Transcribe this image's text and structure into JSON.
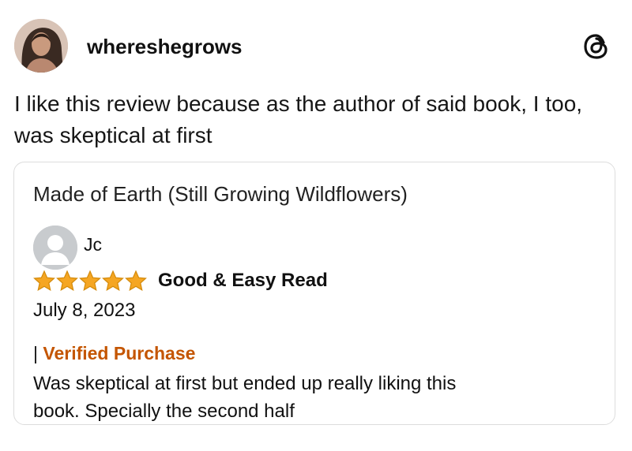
{
  "post": {
    "username": "whereshegrows",
    "text_line1": "I like this review because as the author of said book, I too,",
    "text_line2": "was skeptical at first"
  },
  "review_card": {
    "book_title": "Made of Earth (Still Growing Wildflowers)",
    "reviewer_name": "Jc",
    "rating": 5,
    "rating_max": 5,
    "review_title": "Good & Easy Read",
    "date": "July 8, 2023",
    "separator": "|",
    "verified_label": "Verified Purchase",
    "body_line1": "Was skeptical at first but ended up really liking this",
    "body_line2": "book. Specially the second half"
  },
  "icons": {
    "threads": "threads-logo-icon",
    "star": "star-icon",
    "default_avatar": "user-silhouette-icon"
  },
  "colors": {
    "star": "#f5a623",
    "star_stroke": "#d48a0a",
    "verified": "#c45500",
    "card_border": "#dddddd"
  }
}
